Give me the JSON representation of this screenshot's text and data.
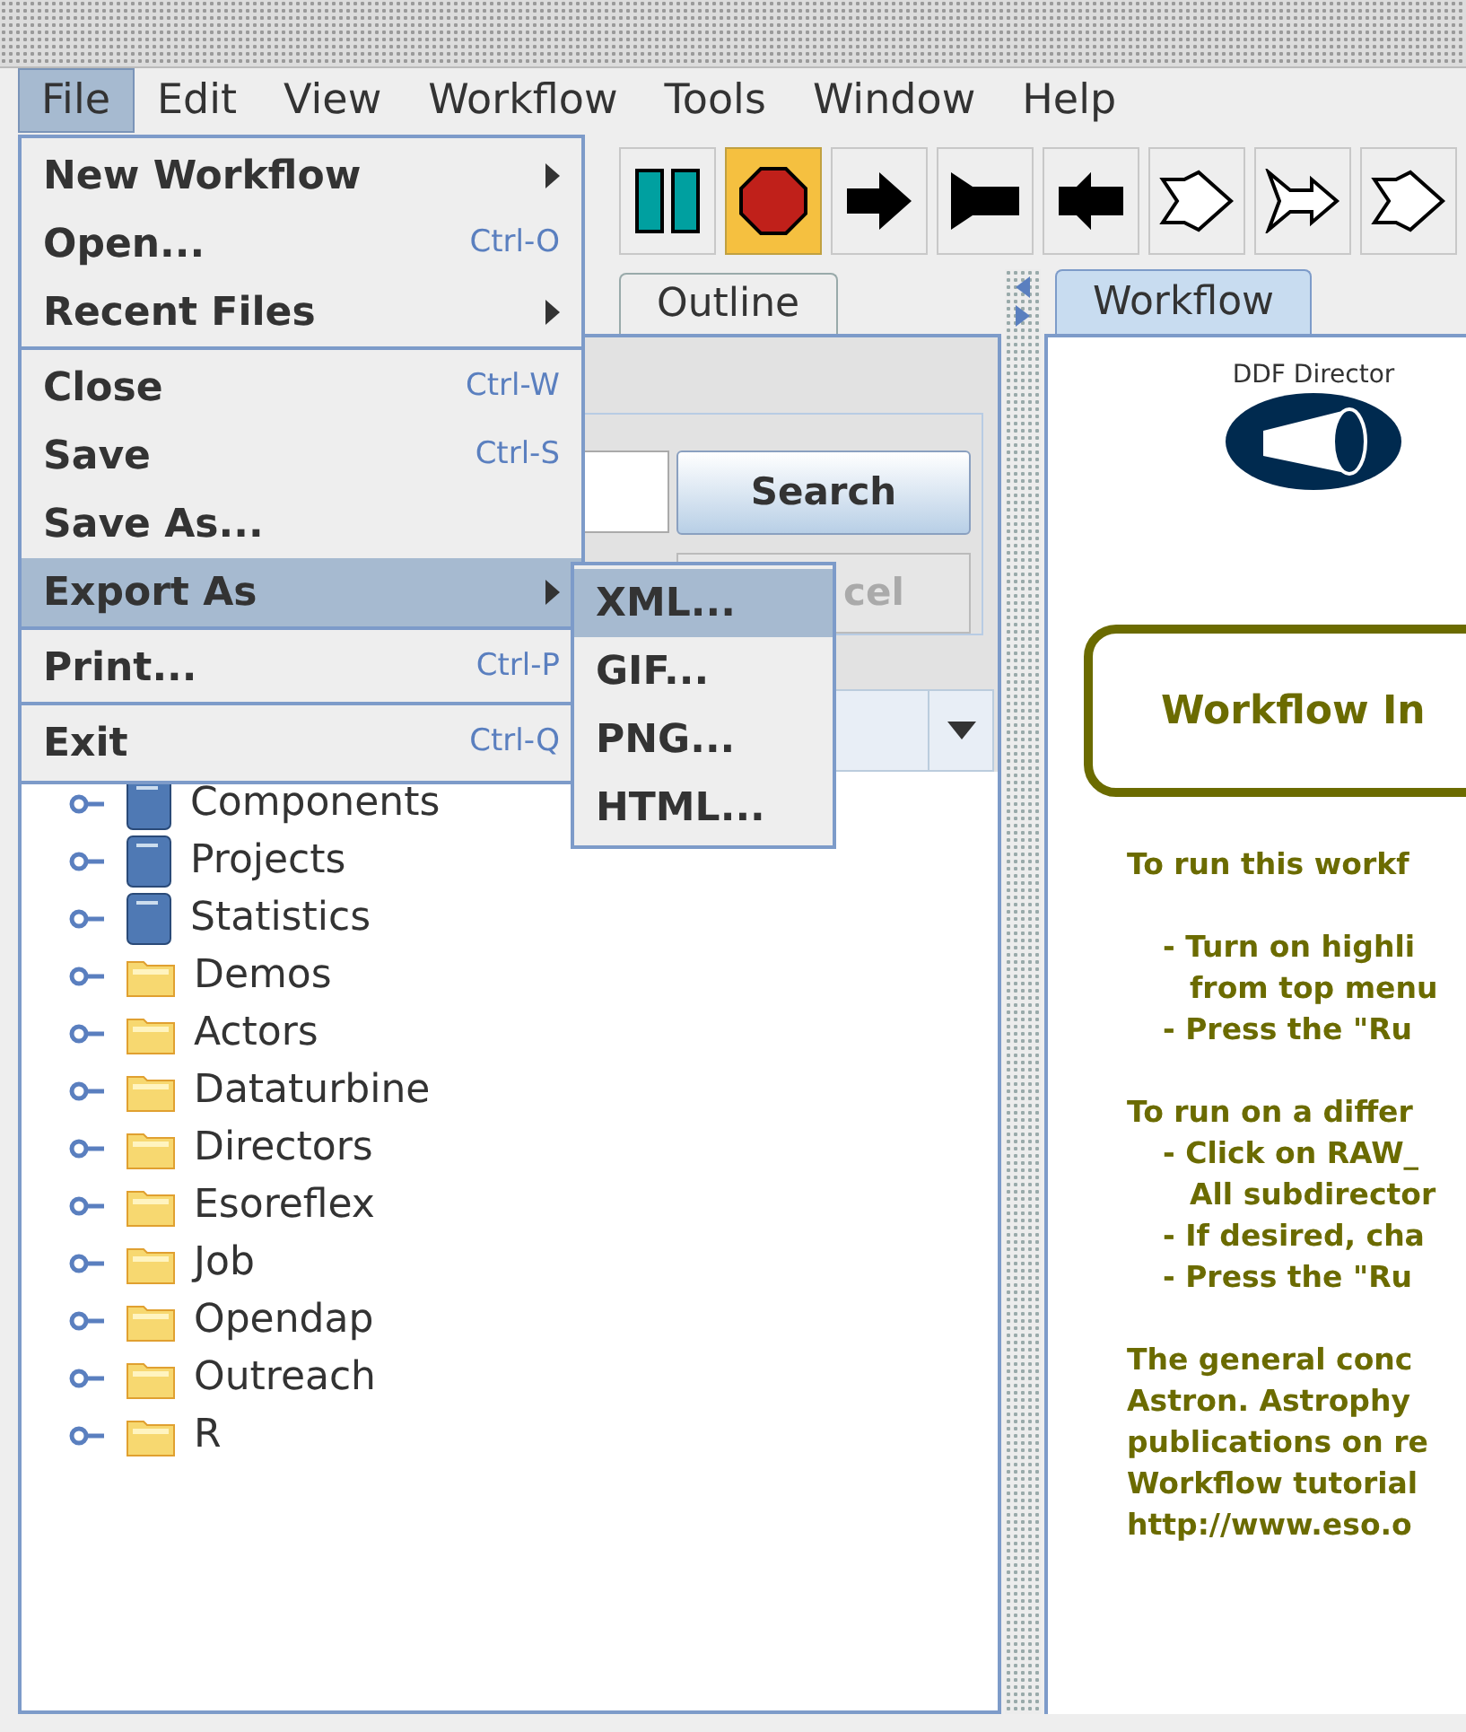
{
  "menubar": [
    {
      "label": "File",
      "selected": true
    },
    {
      "label": "Edit",
      "selected": false
    },
    {
      "label": "View",
      "selected": false
    },
    {
      "label": "Workflow",
      "selected": false
    },
    {
      "label": "Tools",
      "selected": false
    },
    {
      "label": "Window",
      "selected": false
    },
    {
      "label": "Help",
      "selected": false
    }
  ],
  "toolbar": [
    {
      "kind": "pause",
      "selected": false
    },
    {
      "kind": "stop",
      "selected": true
    },
    {
      "kind": "arrow",
      "selected": false
    },
    {
      "kind": "flag",
      "selected": false
    },
    {
      "kind": "short-arrow",
      "selected": false
    },
    {
      "kind": "hollow-double",
      "selected": false
    },
    {
      "kind": "hollow-flag",
      "selected": false
    },
    {
      "kind": "hollow-double",
      "selected": false
    }
  ],
  "left_tabs": [
    {
      "label": "Outline",
      "selected": false
    }
  ],
  "search": {
    "button": "Search",
    "cancel_button": "cel",
    "cancel_disabled": true
  },
  "tree": [
    {
      "label": "Components",
      "kind": "library",
      "expanded": false
    },
    {
      "label": "Projects",
      "kind": "library",
      "expanded": false
    },
    {
      "label": "Statistics",
      "kind": "library",
      "expanded": false
    },
    {
      "label": "Demos",
      "kind": "folder",
      "expanded": false
    },
    {
      "label": "Actors",
      "kind": "folder",
      "expanded": false
    },
    {
      "label": "Dataturbine",
      "kind": "folder",
      "expanded": false
    },
    {
      "label": "Directors",
      "kind": "folder",
      "expanded": false
    },
    {
      "label": "Esoreflex",
      "kind": "folder",
      "expanded": false
    },
    {
      "label": "Job",
      "kind": "folder",
      "expanded": false
    },
    {
      "label": "Opendap",
      "kind": "folder",
      "expanded": false
    },
    {
      "label": "Outreach",
      "kind": "folder",
      "expanded": false
    },
    {
      "label": "R",
      "kind": "folder",
      "expanded": false
    }
  ],
  "right_tabs": [
    {
      "label": "Workflow",
      "selected": true
    }
  ],
  "canvas": {
    "director_label": "DDF Director",
    "box_title": "Workflow In",
    "paragraphs": [
      {
        "kind": "heading",
        "lines": [
          "To run this workf"
        ]
      },
      {
        "kind": "gap"
      },
      {
        "kind": "bullet",
        "lines": [
          "- Turn on highli",
          "from top menu"
        ]
      },
      {
        "kind": "bullet",
        "lines": [
          "- Press the \"Ru"
        ]
      },
      {
        "kind": "gap"
      },
      {
        "kind": "heading",
        "lines": [
          "To run on a differ"
        ]
      },
      {
        "kind": "bullet",
        "lines": [
          "- Click on RAW_",
          "All subdirector"
        ]
      },
      {
        "kind": "bullet",
        "lines": [
          "- If desired, cha"
        ]
      },
      {
        "kind": "bullet",
        "lines": [
          "- Press the \"Ru"
        ]
      },
      {
        "kind": "gap"
      },
      {
        "kind": "heading",
        "lines": [
          "The general conc",
          "Astron. Astrophy",
          "publications on re",
          "Workflow tutorial",
          "http://www.eso.o"
        ]
      }
    ]
  },
  "file_menu": {
    "groups": [
      [
        {
          "label": "New Workflow",
          "kind": "submenu",
          "selected": false
        },
        {
          "label": "Open...",
          "shortcut": "Ctrl-O",
          "kind": "item",
          "selected": false
        },
        {
          "label": "Recent Files",
          "kind": "submenu",
          "selected": false
        }
      ],
      [
        {
          "label": "Close",
          "shortcut": "Ctrl-W",
          "kind": "item",
          "selected": false
        },
        {
          "label": "Save",
          "shortcut": "Ctrl-S",
          "kind": "item",
          "selected": false
        },
        {
          "label": "Save As...",
          "kind": "item",
          "selected": false
        },
        {
          "label": "Export As",
          "kind": "submenu",
          "selected": true
        }
      ],
      [
        {
          "label": "Print...",
          "shortcut": "Ctrl-P",
          "kind": "item",
          "selected": false
        }
      ],
      [
        {
          "label": "Exit",
          "shortcut": "Ctrl-Q",
          "kind": "item",
          "selected": false
        }
      ]
    ]
  },
  "export_submenu": [
    {
      "label": "XML...",
      "selected": true
    },
    {
      "label": "GIF...",
      "selected": false
    },
    {
      "label": "PNG...",
      "selected": false
    },
    {
      "label": "HTML...",
      "selected": false
    }
  ]
}
